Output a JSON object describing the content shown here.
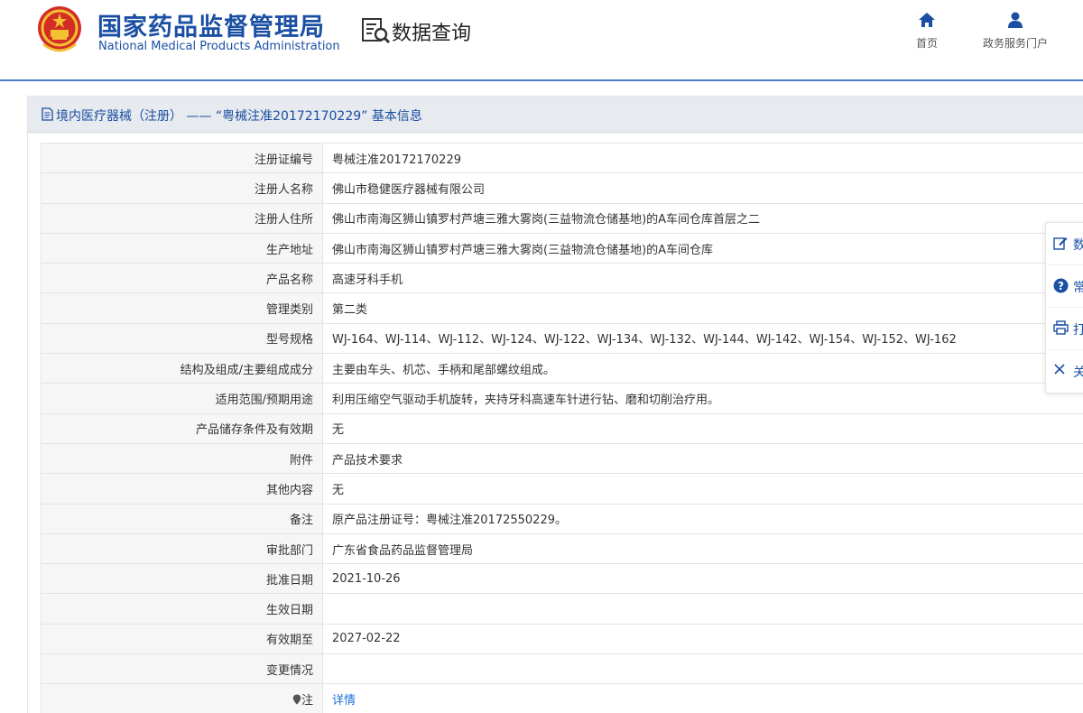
{
  "header": {
    "agency_cn": "国家药品监督管理局",
    "agency_en": "National Medical Products Administration",
    "query_title": "数据查询",
    "nav": [
      {
        "label": "首页",
        "icon": "home-icon"
      },
      {
        "label": "政务服务门户",
        "icon": "user-icon"
      }
    ]
  },
  "panel": {
    "title": "境内医疗器械（注册） —— “粤械注准20172170229” 基本信息"
  },
  "table": {
    "rows": [
      {
        "label": "注册证编号",
        "value": "粤械注准20172170229"
      },
      {
        "label": "注册人名称",
        "value": "佛山市稳健医疗器械有限公司"
      },
      {
        "label": "注册人住所",
        "value": "佛山市南海区狮山镇罗村芦塘三雅大雾岗(三益物流仓储基地)的A车间仓库首层之二"
      },
      {
        "label": "生产地址",
        "value": "佛山市南海区狮山镇罗村芦塘三雅大雾岗(三益物流仓储基地)的A车间仓库"
      },
      {
        "label": "产品名称",
        "value": "高速牙科手机"
      },
      {
        "label": "管理类别",
        "value": "第二类"
      },
      {
        "label": "型号规格",
        "value": "WJ-164、WJ-114、WJ-112、WJ-124、WJ-122、WJ-134、WJ-132、WJ-144、WJ-142、WJ-154、WJ-152、WJ-162"
      },
      {
        "label": "结构及组成/主要组成成分",
        "value": "主要由车头、机芯、手柄和尾部螺纹组成。"
      },
      {
        "label": "适用范围/预期用途",
        "value": "利用压缩空气驱动手机旋转，夹持牙科高速车针进行钻、磨和切削治疗用。"
      },
      {
        "label": "产品储存条件及有效期",
        "value": "无"
      },
      {
        "label": "附件",
        "value": "产品技术要求"
      },
      {
        "label": "其他内容",
        "value": "无"
      },
      {
        "label": "备注",
        "value": "原产品注册证号：粤械注准20172550229。"
      },
      {
        "label": "审批部门",
        "value": "广东省食品药品监督管理局"
      },
      {
        "label": "批准日期",
        "value": "2021-10-26"
      },
      {
        "label": "生效日期",
        "value": ""
      },
      {
        "label": "有效期至",
        "value": "2027-02-22"
      },
      {
        "label": "变更情况",
        "value": ""
      },
      {
        "label": "注",
        "value": "详情",
        "icon": "pin-icon"
      }
    ]
  },
  "side_toolbar": [
    {
      "label": "数",
      "icon": "edit-icon"
    },
    {
      "label": "常",
      "icon": "help-icon"
    },
    {
      "label": "打",
      "icon": "print-icon"
    },
    {
      "label": "关",
      "icon": "close-icon"
    }
  ],
  "colors": {
    "brand": "#1b4fa3",
    "link": "#1b6ed6",
    "divider": "#4a7cc7"
  }
}
